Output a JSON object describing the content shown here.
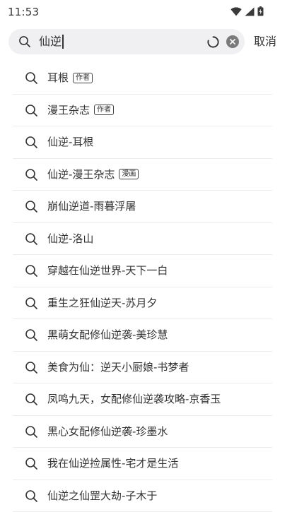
{
  "status_bar": {
    "time": "11:53",
    "icons": [
      "wifi-icon",
      "signal-icon",
      "battery-icon"
    ]
  },
  "search": {
    "query": "仙逆",
    "cancel_label": "取消"
  },
  "suggestions": [
    {
      "label": "耳根",
      "tag": "作者"
    },
    {
      "label": "漫王杂志",
      "tag": "作者"
    },
    {
      "label": "仙逆-耳根",
      "tag": ""
    },
    {
      "label": "仙逆-漫王杂志",
      "tag": "漫画"
    },
    {
      "label": "崩仙逆道-雨暮浮屠",
      "tag": ""
    },
    {
      "label": "仙逆-洛山",
      "tag": ""
    },
    {
      "label": "穿越在仙逆世界-天下一白",
      "tag": ""
    },
    {
      "label": "重生之狂仙逆天-苏月夕",
      "tag": ""
    },
    {
      "label": "黑萌女配修仙逆袭-美珍慧",
      "tag": ""
    },
    {
      "label": "美食为仙：逆天小厨娘-书梦者",
      "tag": ""
    },
    {
      "label": "凤鸣九天，女配修仙逆袭攻略-京香玉",
      "tag": ""
    },
    {
      "label": "黑心女配修仙逆袭-珍墨水",
      "tag": ""
    },
    {
      "label": "我在仙逆捡属性-宅才是生活",
      "tag": ""
    },
    {
      "label": "仙逆之仙罡大劫-子木于",
      "tag": ""
    }
  ]
}
